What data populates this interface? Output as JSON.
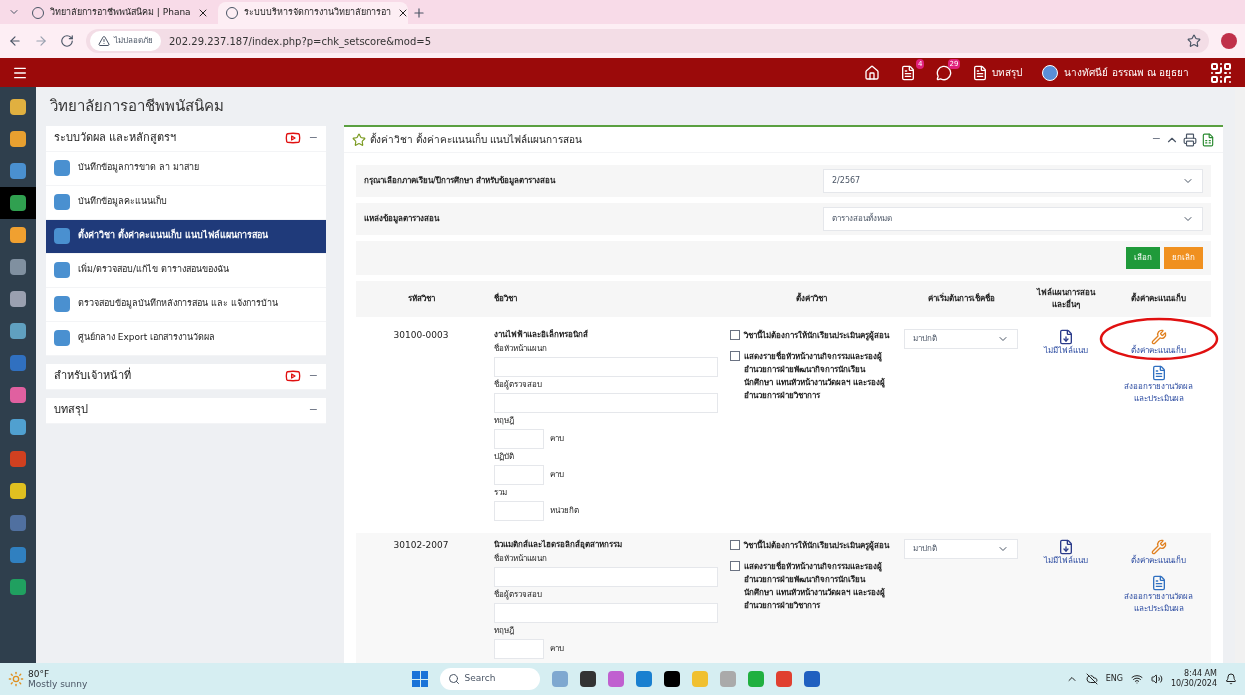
{
  "browser": {
    "tabs": [
      {
        "title": "วิทยาลัยการอาชีพพนัสนิคม | Phana",
        "selected": false
      },
      {
        "title": "ระบบบริหารจัดการงานวิทยาลัยการอา",
        "selected": true
      }
    ],
    "security": "ไม่ปลอดภัย",
    "url": "202.29.237.187/index.php?p=chk_setscore&mod=5"
  },
  "header": {
    "badges": [
      "4",
      "29"
    ],
    "summary": "บทสรุป",
    "user": "นางทัศนีย์ อรรณพ ณ อยุธยา"
  },
  "rail": [
    {
      "selected": false
    },
    {
      "selected": false
    },
    {
      "selected": false
    },
    {
      "selected": true
    },
    {
      "selected": false
    },
    {
      "selected": false
    },
    {
      "selected": false
    },
    {
      "selected": false
    },
    {
      "selected": false
    },
    {
      "selected": false
    },
    {
      "selected": false
    },
    {
      "selected": false
    },
    {
      "selected": false
    },
    {
      "selected": false
    },
    {
      "selected": false
    },
    {
      "selected": false
    }
  ],
  "sidebar": {
    "title": "วิทยาลัยการอาชีพพนัสนิคม",
    "sections": [
      {
        "title": "ระบบวัดผล และหลักสูตรฯ",
        "video": true,
        "toggle": "−",
        "items": [
          {
            "label": "บันทึกข้อมูลการขาด ลา มาสาย",
            "selected": false
          },
          {
            "label": "บันทึกข้อมูลคะแนนเก็บ",
            "selected": false
          },
          {
            "label": "ตั้งค่าวิชา ตั้งค่าคะแนนเก็บ แนบไฟล์แผนการสอน",
            "selected": true
          },
          {
            "label": "เพิ่ม/ตรวจสอบ/แก้ไข ตารางสอนของฉัน",
            "selected": false
          },
          {
            "label": "ตรวจสอบข้อมูลบันทึกหลังการสอน และ แจ้งการบ้าน",
            "selected": false
          },
          {
            "label": "ศูนย์กลาง Export เอกสารงานวัดผล",
            "selected": false
          }
        ]
      },
      {
        "title": "สำหรับเจ้าหน้าที่",
        "video": true,
        "toggle": "−"
      },
      {
        "title": "บทสรุป",
        "video": false,
        "toggle": "−"
      }
    ]
  },
  "panel": {
    "title": "ตั้งค่าวิชา ตั้งค่าคะแนนเก็บ แนบไฟล์แผนการสอน",
    "toggle": "−",
    "filters": [
      {
        "label": "กรุณาเลือกภาคเรียน/ปีการศึกษา สำหรับข้อมูลตารางสอน",
        "value": "2/2567"
      },
      {
        "label": "แหล่งข้อมูลตารางสอน",
        "value": "ตารางสอนทั้งหมด"
      }
    ],
    "buttons": [
      {
        "label": "เลือก",
        "kind": "primary"
      },
      {
        "label": "ยกเลิก",
        "kind": "warning"
      }
    ],
    "columns": [
      "รหัสวิชา",
      "ชื่อวิชา",
      "ตั้งค่าวิชา",
      "ค่าเริ่มต้นการเช็คชื่อ",
      "ไฟล์แผนการสอน และอื่นๆ",
      "ตั้งค่าคะแนนเก็บ"
    ],
    "rows": [
      {
        "code": "30100-0003",
        "name": "งานไฟฟ้าและอิเล็กทรอนิกส์",
        "fields": [
          {
            "label": "ชื่อหัวหน้าแผนก",
            "kind": "wide"
          },
          {
            "label": "ชื่อผู้ตรวจสอบ",
            "kind": "wide"
          },
          {
            "label": "ทฤษฎี",
            "kind": "short",
            "unit": "คาบ"
          },
          {
            "label": "ปฏิบัติ",
            "kind": "short",
            "unit": "คาบ"
          },
          {
            "label": "รวม",
            "kind": "short",
            "unit": "หน่วยกิต"
          }
        ],
        "checks": [
          {
            "label": "วิชานี้ไม่ต้องการให้นักเรียนประเมินครูผู้สอน",
            "checked": false
          },
          {
            "label": "แสดงรายชื่อหัวหน้างานกิจกรรมและรองผู้อำนวยการฝ่ายพัฒนากิจการนักเรียนนักศึกษา แทนหัวหน้างานวัดผลฯ และรองผู้อำนวยการฝ่ายวิชาการ",
            "checked": false
          }
        ],
        "attendance": "มาปกติ",
        "file": "ไม่มีไฟล์แนบ",
        "actions": [
          {
            "label": "ตั้งค่าคะแนนเก็บ",
            "kind": "settings",
            "circled": true
          },
          {
            "label": "ส่งออกรายงานวัดผลและประเมินผล",
            "kind": "export",
            "circled": false
          }
        ]
      },
      {
        "code": "30102-2007",
        "name": "นิวแมติกส์และไฮดรอลิกส์อุตสาหกรรม",
        "fields": [
          {
            "label": "ชื่อหัวหน้าแผนก",
            "kind": "wide"
          },
          {
            "label": "ชื่อผู้ตรวจสอบ",
            "kind": "wide"
          },
          {
            "label": "ทฤษฎี",
            "kind": "short",
            "unit": "คาบ"
          }
        ],
        "checks": [
          {
            "label": "วิชานี้ไม่ต้องการให้นักเรียนประเมินครูผู้สอน",
            "checked": false
          },
          {
            "label": "แสดงรายชื่อหัวหน้างานกิจกรรมและรองผู้อำนวยการฝ่ายพัฒนากิจการนักเรียนนักศึกษา แทนหัวหน้างานวัดผลฯ และรองผู้อำนวยการฝ่ายวิชาการ",
            "checked": false
          }
        ],
        "attendance": "มาปกติ",
        "file": "ไม่มีไฟล์แนบ",
        "actions": [
          {
            "label": "ตั้งค่าคะแนนเก็บ",
            "kind": "settings",
            "circled": false
          },
          {
            "label": "ส่งออกรายงานวัดผลและประเมินผล",
            "kind": "export",
            "circled": false
          }
        ]
      }
    ]
  },
  "taskbar": {
    "temperature": "80°F",
    "weather": "Mostly sunny",
    "search": "Search",
    "language": "ENG",
    "time": "8:44 AM",
    "date": "10/30/2024"
  }
}
